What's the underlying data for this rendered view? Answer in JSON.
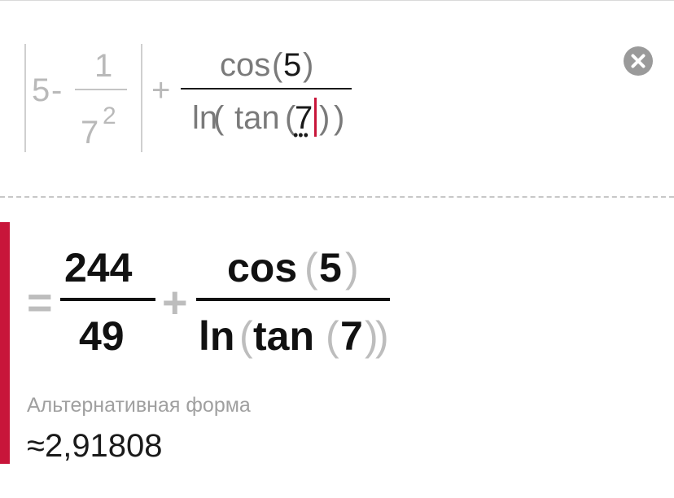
{
  "input": {
    "abs_term": {
      "whole": "5",
      "minus": "-",
      "numerator": "1",
      "denom_base": "7",
      "denom_exp": "2"
    },
    "plus": "+",
    "fraction": {
      "num_func": "cos",
      "num_open": "(",
      "num_arg": "5",
      "num_close": ")",
      "den_ln": "ln",
      "den_open": "(",
      "den_func": "tan",
      "den_inner_open": "(",
      "den_arg": "7",
      "den_inner_close": ")",
      "den_close": ")"
    },
    "clear_icon": "close-circle-icon"
  },
  "result": {
    "equals": "=",
    "frac1": {
      "numerator": "244",
      "denominator": "49"
    },
    "plus": "+",
    "frac2": {
      "num_func": "cos",
      "num_open": "(",
      "num_arg": "5",
      "num_close": ")",
      "den_ln": "ln",
      "den_open": "(",
      "den_func": "tan",
      "den_inner_open": "(",
      "den_arg": "7",
      "den_inner_close": ")",
      "den_close": ")"
    }
  },
  "alternative": {
    "label": "Альтернативная форма",
    "value": "≈2,91808"
  },
  "colors": {
    "accent": "#c8153a",
    "muted": "#bdbdbd"
  }
}
